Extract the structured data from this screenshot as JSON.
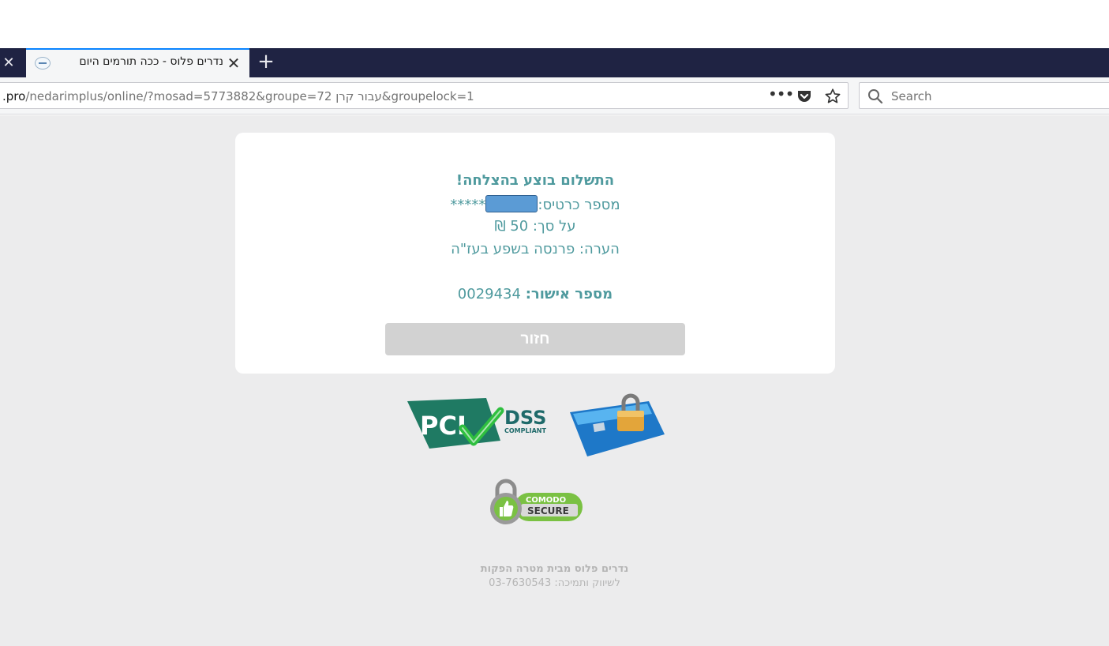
{
  "browser": {
    "tab": {
      "title": "נדרים פלוס - ככה תורמים היום"
    },
    "url": {
      "host": ".pro",
      "path": "/nedarimplus/online/?mosad=5773882&groupe=72 עבור קרן&groupelock=1"
    },
    "search": {
      "placeholder": "Search"
    }
  },
  "receipt": {
    "success_title": "התשלום בוצע בהצלחה!",
    "card_label": "מספר כרטיס:",
    "card_mask": "*****",
    "amount_line": "על סך: 50 ₪",
    "note_line": "הערה: פרנסה בשפע בעז\"ה",
    "approval_label": "מספר אישור:",
    "approval_number": "0029434",
    "back_button": "חזור"
  },
  "badges": {
    "pci_main": "PCI",
    "pci_dss": "DSS",
    "pci_compliant": "COMPLIANT",
    "comodo_top": "COMODO",
    "comodo_bottom": "SECURE"
  },
  "footer": {
    "line1": "נדרים פלוס מבית מטרה הפקות",
    "line2": "לשיווק ותמיכה: 03-7630543"
  },
  "colors": {
    "tabbar": "#1f2343",
    "accent_text": "#4f9a9e",
    "page_bg": "#ececed",
    "button_bg": "#d2d2d2",
    "pci_green": "#1f7a63",
    "check_green": "#2fbf3f",
    "comodo_green": "#7ac143"
  }
}
